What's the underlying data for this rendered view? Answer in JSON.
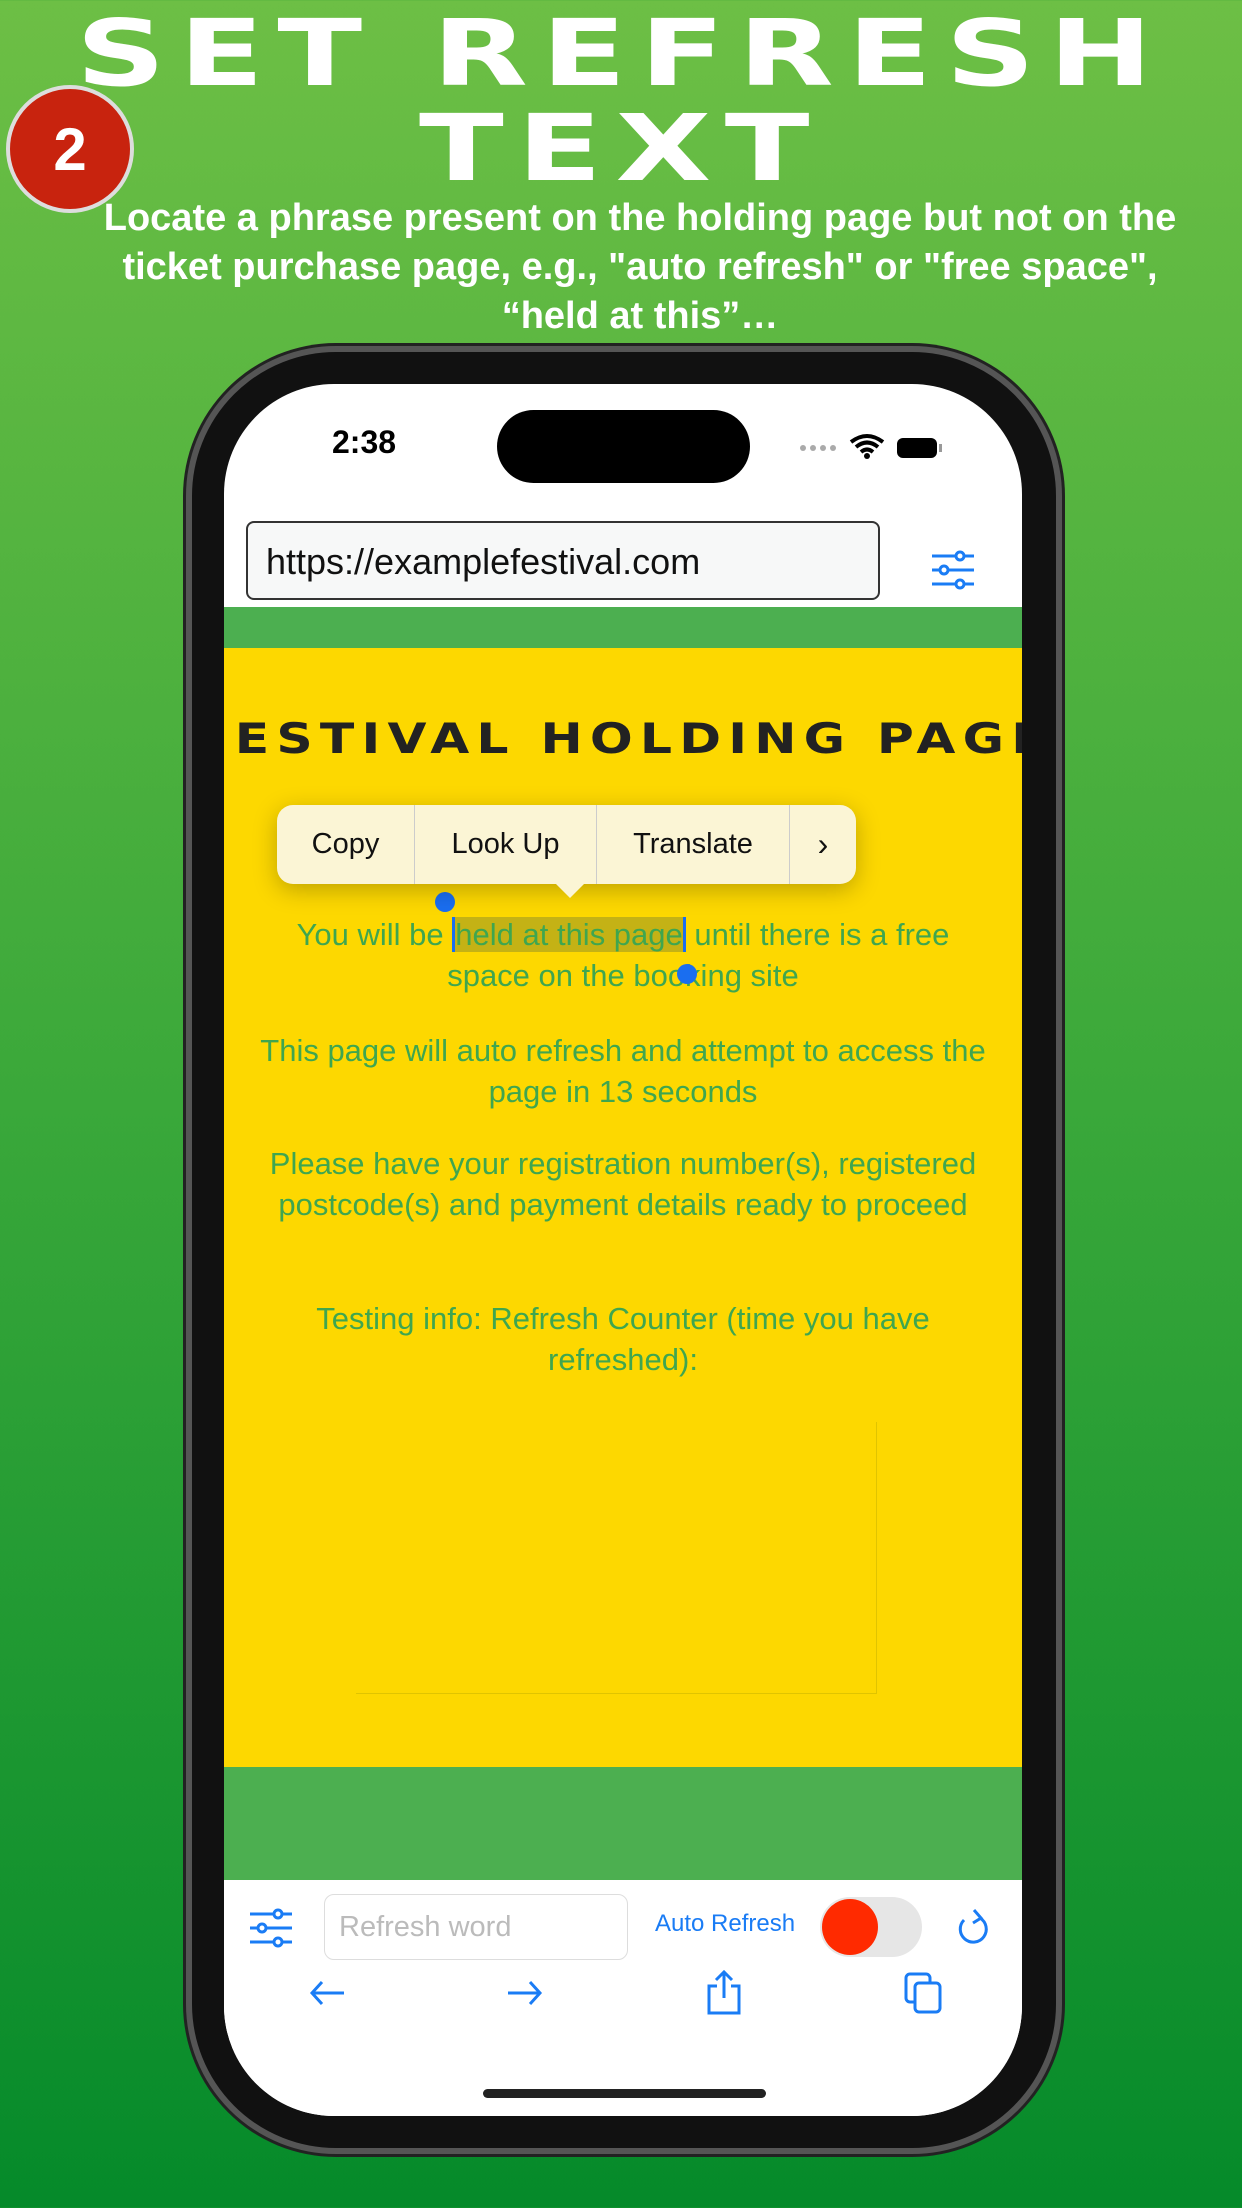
{
  "header": {
    "title_line1": "SET REFRESH",
    "title_line2": "TEXT",
    "step_number": "2",
    "subtitle": "Locate a phrase present on the holding page but not on the ticket purchase page, e.g., \"auto refresh\" or \"free space\", “held at this”…"
  },
  "status_bar": {
    "time": "2:38"
  },
  "browser": {
    "url": "https://examplefestival.com"
  },
  "page": {
    "heading": "FESTIVAL HOLDING PAGE",
    "p1_before": "You will be ",
    "p1_selected": "held at this page",
    "p1_after": " until there is a free space on the booking site",
    "p2": "This page will auto refresh and attempt to access the page in 13 seconds",
    "p3": "Please have your registration number(s), registered postcode(s) and payment details ready to proceed",
    "p4": "Testing info: Refresh Counter (time you have refreshed):"
  },
  "context_menu": {
    "items": [
      "Copy",
      "Look Up",
      "Translate"
    ]
  },
  "toolbar": {
    "refresh_placeholder": "Refresh word",
    "auto_refresh_label": "Auto Refresh",
    "toggle_on": false
  },
  "colors": {
    "accent": "#1a7cf5",
    "page_bg": "#fdd800",
    "band": "#4caf50",
    "toggle_knob": "#ff2a00"
  }
}
